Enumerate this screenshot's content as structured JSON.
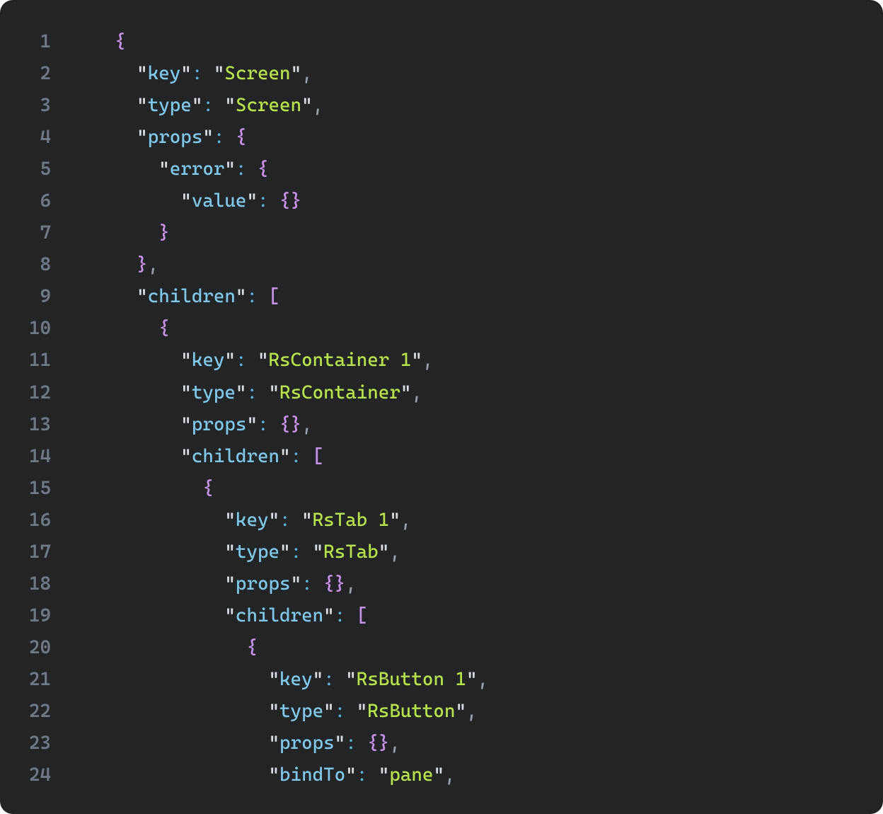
{
  "lines": [
    {
      "n": "1",
      "tokens": [
        {
          "t": "    ",
          "c": "q"
        },
        {
          "t": "{",
          "c": "p"
        }
      ]
    },
    {
      "n": "2",
      "tokens": [
        {
          "t": "      ",
          "c": "q"
        },
        {
          "t": "\"",
          "c": "q"
        },
        {
          "t": "key",
          "c": "k"
        },
        {
          "t": "\"",
          "c": "q"
        },
        {
          "t": ":",
          "c": "c"
        },
        {
          "t": " ",
          "c": "q"
        },
        {
          "t": "\"",
          "c": "q"
        },
        {
          "t": "Screen",
          "c": "s"
        },
        {
          "t": "\"",
          "c": "q"
        },
        {
          "t": ",",
          "c": "cm"
        }
      ]
    },
    {
      "n": "3",
      "tokens": [
        {
          "t": "      ",
          "c": "q"
        },
        {
          "t": "\"",
          "c": "q"
        },
        {
          "t": "type",
          "c": "k"
        },
        {
          "t": "\"",
          "c": "q"
        },
        {
          "t": ":",
          "c": "c"
        },
        {
          "t": " ",
          "c": "q"
        },
        {
          "t": "\"",
          "c": "q"
        },
        {
          "t": "Screen",
          "c": "s"
        },
        {
          "t": "\"",
          "c": "q"
        },
        {
          "t": ",",
          "c": "cm"
        }
      ]
    },
    {
      "n": "4",
      "tokens": [
        {
          "t": "      ",
          "c": "q"
        },
        {
          "t": "\"",
          "c": "q"
        },
        {
          "t": "props",
          "c": "k"
        },
        {
          "t": "\"",
          "c": "q"
        },
        {
          "t": ":",
          "c": "c"
        },
        {
          "t": " ",
          "c": "q"
        },
        {
          "t": "{",
          "c": "p"
        }
      ]
    },
    {
      "n": "5",
      "tokens": [
        {
          "t": "        ",
          "c": "q"
        },
        {
          "t": "\"",
          "c": "q"
        },
        {
          "t": "error",
          "c": "k"
        },
        {
          "t": "\"",
          "c": "q"
        },
        {
          "t": ":",
          "c": "c"
        },
        {
          "t": " ",
          "c": "q"
        },
        {
          "t": "{",
          "c": "p"
        }
      ]
    },
    {
      "n": "6",
      "tokens": [
        {
          "t": "          ",
          "c": "q"
        },
        {
          "t": "\"",
          "c": "q"
        },
        {
          "t": "value",
          "c": "k"
        },
        {
          "t": "\"",
          "c": "q"
        },
        {
          "t": ":",
          "c": "c"
        },
        {
          "t": " ",
          "c": "q"
        },
        {
          "t": "{}",
          "c": "p"
        }
      ]
    },
    {
      "n": "7",
      "tokens": [
        {
          "t": "        ",
          "c": "q"
        },
        {
          "t": "}",
          "c": "p"
        }
      ]
    },
    {
      "n": "8",
      "tokens": [
        {
          "t": "      ",
          "c": "q"
        },
        {
          "t": "}",
          "c": "p"
        },
        {
          "t": ",",
          "c": "cm"
        }
      ]
    },
    {
      "n": "9",
      "tokens": [
        {
          "t": "      ",
          "c": "q"
        },
        {
          "t": "\"",
          "c": "q"
        },
        {
          "t": "children",
          "c": "k"
        },
        {
          "t": "\"",
          "c": "q"
        },
        {
          "t": ":",
          "c": "c"
        },
        {
          "t": " ",
          "c": "q"
        },
        {
          "t": "[",
          "c": "p"
        }
      ]
    },
    {
      "n": "10",
      "tokens": [
        {
          "t": "        ",
          "c": "q"
        },
        {
          "t": "{",
          "c": "p"
        }
      ]
    },
    {
      "n": "11",
      "tokens": [
        {
          "t": "          ",
          "c": "q"
        },
        {
          "t": "\"",
          "c": "q"
        },
        {
          "t": "key",
          "c": "k"
        },
        {
          "t": "\"",
          "c": "q"
        },
        {
          "t": ":",
          "c": "c"
        },
        {
          "t": " ",
          "c": "q"
        },
        {
          "t": "\"",
          "c": "q"
        },
        {
          "t": "RsContainer 1",
          "c": "s"
        },
        {
          "t": "\"",
          "c": "q"
        },
        {
          "t": ",",
          "c": "cm"
        }
      ]
    },
    {
      "n": "12",
      "tokens": [
        {
          "t": "          ",
          "c": "q"
        },
        {
          "t": "\"",
          "c": "q"
        },
        {
          "t": "type",
          "c": "k"
        },
        {
          "t": "\"",
          "c": "q"
        },
        {
          "t": ":",
          "c": "c"
        },
        {
          "t": " ",
          "c": "q"
        },
        {
          "t": "\"",
          "c": "q"
        },
        {
          "t": "RsContainer",
          "c": "s"
        },
        {
          "t": "\"",
          "c": "q"
        },
        {
          "t": ",",
          "c": "cm"
        }
      ]
    },
    {
      "n": "13",
      "tokens": [
        {
          "t": "          ",
          "c": "q"
        },
        {
          "t": "\"",
          "c": "q"
        },
        {
          "t": "props",
          "c": "k"
        },
        {
          "t": "\"",
          "c": "q"
        },
        {
          "t": ":",
          "c": "c"
        },
        {
          "t": " ",
          "c": "q"
        },
        {
          "t": "{}",
          "c": "p"
        },
        {
          "t": ",",
          "c": "cm"
        }
      ]
    },
    {
      "n": "14",
      "tokens": [
        {
          "t": "          ",
          "c": "q"
        },
        {
          "t": "\"",
          "c": "q"
        },
        {
          "t": "children",
          "c": "k"
        },
        {
          "t": "\"",
          "c": "q"
        },
        {
          "t": ":",
          "c": "c"
        },
        {
          "t": " ",
          "c": "q"
        },
        {
          "t": "[",
          "c": "p"
        }
      ]
    },
    {
      "n": "15",
      "tokens": [
        {
          "t": "            ",
          "c": "q"
        },
        {
          "t": "{",
          "c": "p"
        }
      ]
    },
    {
      "n": "16",
      "tokens": [
        {
          "t": "              ",
          "c": "q"
        },
        {
          "t": "\"",
          "c": "q"
        },
        {
          "t": "key",
          "c": "k"
        },
        {
          "t": "\"",
          "c": "q"
        },
        {
          "t": ":",
          "c": "c"
        },
        {
          "t": " ",
          "c": "q"
        },
        {
          "t": "\"",
          "c": "q"
        },
        {
          "t": "RsTab 1",
          "c": "s"
        },
        {
          "t": "\"",
          "c": "q"
        },
        {
          "t": ",",
          "c": "cm"
        }
      ]
    },
    {
      "n": "17",
      "tokens": [
        {
          "t": "              ",
          "c": "q"
        },
        {
          "t": "\"",
          "c": "q"
        },
        {
          "t": "type",
          "c": "k"
        },
        {
          "t": "\"",
          "c": "q"
        },
        {
          "t": ":",
          "c": "c"
        },
        {
          "t": " ",
          "c": "q"
        },
        {
          "t": "\"",
          "c": "q"
        },
        {
          "t": "RsTab",
          "c": "s"
        },
        {
          "t": "\"",
          "c": "q"
        },
        {
          "t": ",",
          "c": "cm"
        }
      ]
    },
    {
      "n": "18",
      "tokens": [
        {
          "t": "              ",
          "c": "q"
        },
        {
          "t": "\"",
          "c": "q"
        },
        {
          "t": "props",
          "c": "k"
        },
        {
          "t": "\"",
          "c": "q"
        },
        {
          "t": ":",
          "c": "c"
        },
        {
          "t": " ",
          "c": "q"
        },
        {
          "t": "{}",
          "c": "p"
        },
        {
          "t": ",",
          "c": "cm"
        }
      ]
    },
    {
      "n": "19",
      "tokens": [
        {
          "t": "              ",
          "c": "q"
        },
        {
          "t": "\"",
          "c": "q"
        },
        {
          "t": "children",
          "c": "k"
        },
        {
          "t": "\"",
          "c": "q"
        },
        {
          "t": ":",
          "c": "c"
        },
        {
          "t": " ",
          "c": "q"
        },
        {
          "t": "[",
          "c": "p"
        }
      ]
    },
    {
      "n": "20",
      "tokens": [
        {
          "t": "                ",
          "c": "q"
        },
        {
          "t": "{",
          "c": "p"
        }
      ]
    },
    {
      "n": "21",
      "tokens": [
        {
          "t": "                  ",
          "c": "q"
        },
        {
          "t": "\"",
          "c": "q"
        },
        {
          "t": "key",
          "c": "k"
        },
        {
          "t": "\"",
          "c": "q"
        },
        {
          "t": ":",
          "c": "c"
        },
        {
          "t": " ",
          "c": "q"
        },
        {
          "t": "\"",
          "c": "q"
        },
        {
          "t": "RsButton 1",
          "c": "s"
        },
        {
          "t": "\"",
          "c": "q"
        },
        {
          "t": ",",
          "c": "cm"
        }
      ]
    },
    {
      "n": "22",
      "tokens": [
        {
          "t": "                  ",
          "c": "q"
        },
        {
          "t": "\"",
          "c": "q"
        },
        {
          "t": "type",
          "c": "k"
        },
        {
          "t": "\"",
          "c": "q"
        },
        {
          "t": ":",
          "c": "c"
        },
        {
          "t": " ",
          "c": "q"
        },
        {
          "t": "\"",
          "c": "q"
        },
        {
          "t": "RsButton",
          "c": "s"
        },
        {
          "t": "\"",
          "c": "q"
        },
        {
          "t": ",",
          "c": "cm"
        }
      ]
    },
    {
      "n": "23",
      "tokens": [
        {
          "t": "                  ",
          "c": "q"
        },
        {
          "t": "\"",
          "c": "q"
        },
        {
          "t": "props",
          "c": "k"
        },
        {
          "t": "\"",
          "c": "q"
        },
        {
          "t": ":",
          "c": "c"
        },
        {
          "t": " ",
          "c": "q"
        },
        {
          "t": "{}",
          "c": "p"
        },
        {
          "t": ",",
          "c": "cm"
        }
      ]
    },
    {
      "n": "24",
      "tokens": [
        {
          "t": "                  ",
          "c": "q"
        },
        {
          "t": "\"",
          "c": "q"
        },
        {
          "t": "bindTo",
          "c": "k"
        },
        {
          "t": "\"",
          "c": "q"
        },
        {
          "t": ":",
          "c": "c"
        },
        {
          "t": " ",
          "c": "q"
        },
        {
          "t": "\"",
          "c": "q"
        },
        {
          "t": "pane",
          "c": "s"
        },
        {
          "t": "\"",
          "c": "q"
        },
        {
          "t": ",",
          "c": "cm"
        }
      ]
    }
  ]
}
